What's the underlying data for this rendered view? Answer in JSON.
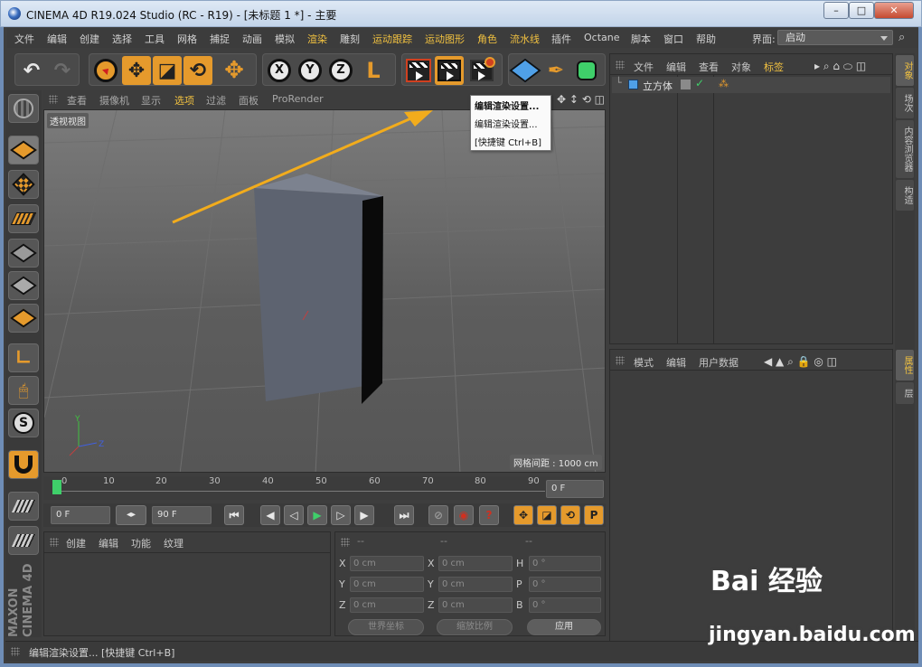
{
  "window": {
    "title": "CINEMA 4D R19.024 Studio (RC - R19) - [未标题 1 *] - 主要",
    "min": "–",
    "max": "□",
    "close": "✕"
  },
  "menu": [
    "文件",
    "编辑",
    "创建",
    "选择",
    "工具",
    "网格",
    "捕捉",
    "动画",
    "模拟",
    "渲染",
    "雕刻",
    "运动跟踪",
    "运动图形",
    "角色",
    "流水线",
    "插件",
    "Octane",
    "脚本",
    "窗口",
    "帮助"
  ],
  "menu_highlight": [
    9,
    11,
    12,
    13,
    14
  ],
  "interface": {
    "label": "界面:",
    "value": "启动"
  },
  "toolbar": {
    "undo": "↶",
    "redo": "↷",
    "move": "✥",
    "scale": "◪",
    "rotate": "⟲",
    "axis_x": "X",
    "axis_y": "Y",
    "axis_z": "Z",
    "coord": "L"
  },
  "viewport": {
    "menu": [
      "查看",
      "摄像机",
      "显示",
      "选项",
      "过滤",
      "面板",
      "ProRender"
    ],
    "selected_menu": 3,
    "label": "透视视图",
    "grid": "网格间距 : 1000 cm"
  },
  "tooltip": {
    "title": "编辑渲染设置...",
    "line1": "编辑渲染设置...",
    "line2": "[快捷键 Ctrl+B]"
  },
  "timeline": {
    "ticks": [
      "0",
      "10",
      "20",
      "30",
      "40",
      "50",
      "60",
      "70",
      "80",
      "90"
    ],
    "current": "0 F",
    "start": "0 F",
    "end": "90 F"
  },
  "playback": {
    "first": "⏮",
    "prev": "◀",
    "back": "◁",
    "play": "▶",
    "fwd": "▷",
    "next": "▶",
    "last": "⏭"
  },
  "material": {
    "menu": [
      "创建",
      "编辑",
      "功能",
      "纹理"
    ]
  },
  "coords": {
    "head": [
      "--",
      "--",
      "--"
    ],
    "labels_l": [
      "X",
      "Y",
      "Z"
    ],
    "labels_m": [
      "X",
      "Y",
      "Z"
    ],
    "labels_r": [
      "H",
      "P",
      "B"
    ],
    "pos": [
      "0 cm",
      "0 cm",
      "0 cm"
    ],
    "size": [
      "0 cm",
      "0 cm",
      "0 cm"
    ],
    "rot": [
      "0 °",
      "0 °",
      "0 °"
    ],
    "world": "世界坐标",
    "scale": "缩放比例",
    "apply": "应用"
  },
  "objects": {
    "menu": [
      "文件",
      "编辑",
      "查看",
      "对象",
      "标签"
    ],
    "cube": "立方体"
  },
  "attributes": {
    "menu": [
      "模式",
      "编辑",
      "用户数据"
    ]
  },
  "side_tabs": {
    "top": [
      "对象",
      "场次",
      "内容浏览器",
      "构造"
    ],
    "bottom": [
      "属性",
      "层"
    ]
  },
  "status": "编辑渲染设置... [快捷键 Ctrl+B]",
  "brand": "MAXON CINEMA 4D",
  "watermark": {
    "brand": "Bai 经验",
    "url": "jingyan.baidu.com"
  },
  "colors": {
    "accent": "#f0c040",
    "orange": "#e59a2c",
    "panel": "#3d3d3d"
  }
}
